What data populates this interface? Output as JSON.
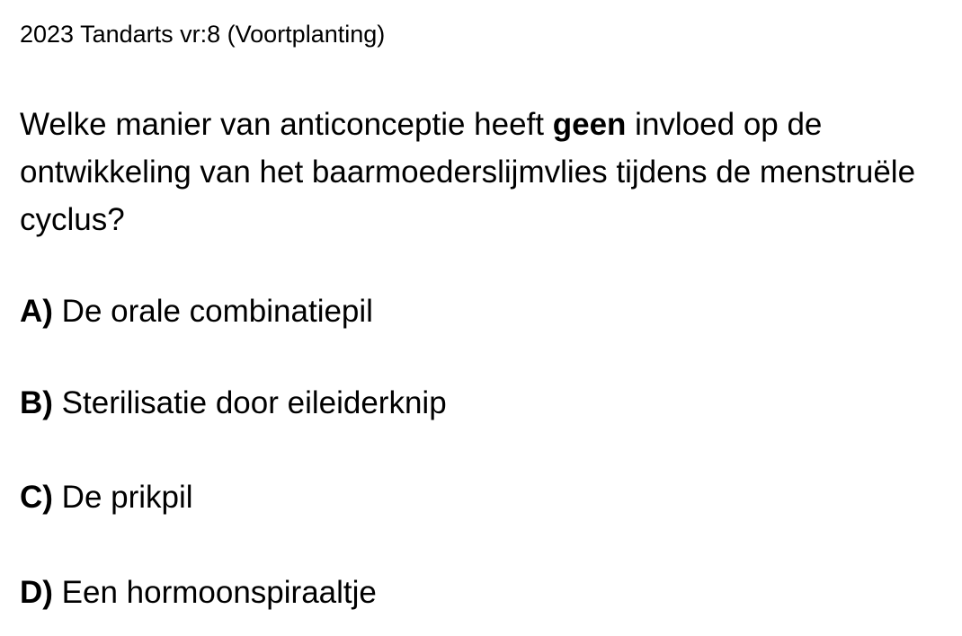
{
  "header": {
    "title": "2023 Tandarts vr:8 (Voortplanting)"
  },
  "question": {
    "before": "Welke manier van anticonceptie heeft ",
    "emphasis": "geen",
    "after": " invloed op de ontwikkeling van het baarmoederslijmvlies tijdens de menstruële cyclus?"
  },
  "options": [
    {
      "letter": "A)",
      "text": " De orale combinatiepil"
    },
    {
      "letter": "B)",
      "text": " Sterilisatie door eileiderknip"
    },
    {
      "letter": "C)",
      "text": " De prikpil"
    },
    {
      "letter": "D)",
      "text": " Een hormoonspiraaltje"
    }
  ]
}
